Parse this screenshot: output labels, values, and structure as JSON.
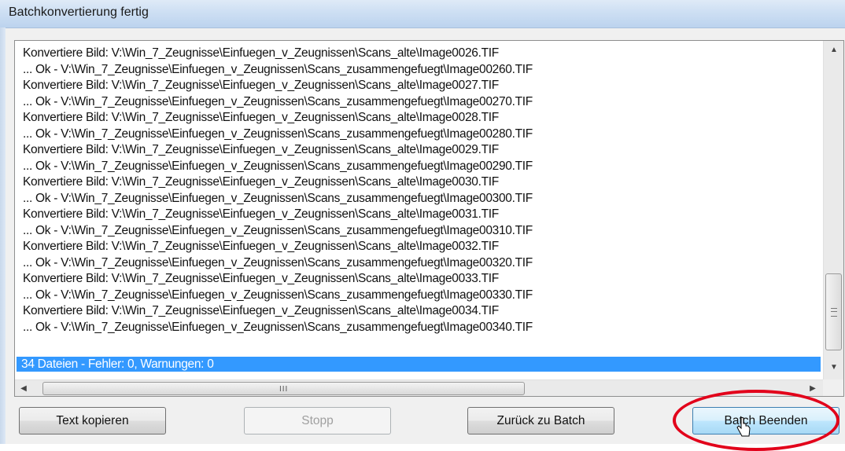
{
  "window": {
    "title": "Batchkonvertierung fertig"
  },
  "log": {
    "lines": [
      "Konvertiere Bild: V:\\Win_7_Zeugnisse\\Einfuegen_v_Zeugnissen\\Scans_alte\\Image0026.TIF",
      "... Ok - V:\\Win_7_Zeugnisse\\Einfuegen_v_Zeugnissen\\Scans_zusammengefuegt\\Image00260.TIF",
      "Konvertiere Bild: V:\\Win_7_Zeugnisse\\Einfuegen_v_Zeugnissen\\Scans_alte\\Image0027.TIF",
      "... Ok - V:\\Win_7_Zeugnisse\\Einfuegen_v_Zeugnissen\\Scans_zusammengefuegt\\Image00270.TIF",
      "Konvertiere Bild: V:\\Win_7_Zeugnisse\\Einfuegen_v_Zeugnissen\\Scans_alte\\Image0028.TIF",
      "... Ok - V:\\Win_7_Zeugnisse\\Einfuegen_v_Zeugnissen\\Scans_zusammengefuegt\\Image00280.TIF",
      "Konvertiere Bild: V:\\Win_7_Zeugnisse\\Einfuegen_v_Zeugnissen\\Scans_alte\\Image0029.TIF",
      "... Ok - V:\\Win_7_Zeugnisse\\Einfuegen_v_Zeugnissen\\Scans_zusammengefuegt\\Image00290.TIF",
      "Konvertiere Bild: V:\\Win_7_Zeugnisse\\Einfuegen_v_Zeugnissen\\Scans_alte\\Image0030.TIF",
      "... Ok - V:\\Win_7_Zeugnisse\\Einfuegen_v_Zeugnissen\\Scans_zusammengefuegt\\Image00300.TIF",
      "Konvertiere Bild: V:\\Win_7_Zeugnisse\\Einfuegen_v_Zeugnissen\\Scans_alte\\Image0031.TIF",
      "... Ok - V:\\Win_7_Zeugnisse\\Einfuegen_v_Zeugnissen\\Scans_zusammengefuegt\\Image00310.TIF",
      "Konvertiere Bild: V:\\Win_7_Zeugnisse\\Einfuegen_v_Zeugnissen\\Scans_alte\\Image0032.TIF",
      "... Ok - V:\\Win_7_Zeugnisse\\Einfuegen_v_Zeugnissen\\Scans_zusammengefuegt\\Image00320.TIF",
      "Konvertiere Bild: V:\\Win_7_Zeugnisse\\Einfuegen_v_Zeugnissen\\Scans_alte\\Image0033.TIF",
      "... Ok - V:\\Win_7_Zeugnisse\\Einfuegen_v_Zeugnissen\\Scans_zusammengefuegt\\Image00330.TIF",
      "Konvertiere Bild: V:\\Win_7_Zeugnisse\\Einfuegen_v_Zeugnissen\\Scans_alte\\Image0034.TIF",
      "... Ok - V:\\Win_7_Zeugnisse\\Einfuegen_v_Zeugnissen\\Scans_zusammengefuegt\\Image00340.TIF"
    ],
    "summary": "34 Dateien - Fehler: 0, Warnungen: 0",
    "hscroll_grip": "III"
  },
  "buttons": {
    "copy_label": "Text kopieren",
    "stop_label": "Stopp",
    "back_label": "Zurück zu Batch",
    "finish_label": "Batch Beenden"
  },
  "colors": {
    "selection": "#3399ff",
    "highlight_ellipse": "#e2001a"
  }
}
